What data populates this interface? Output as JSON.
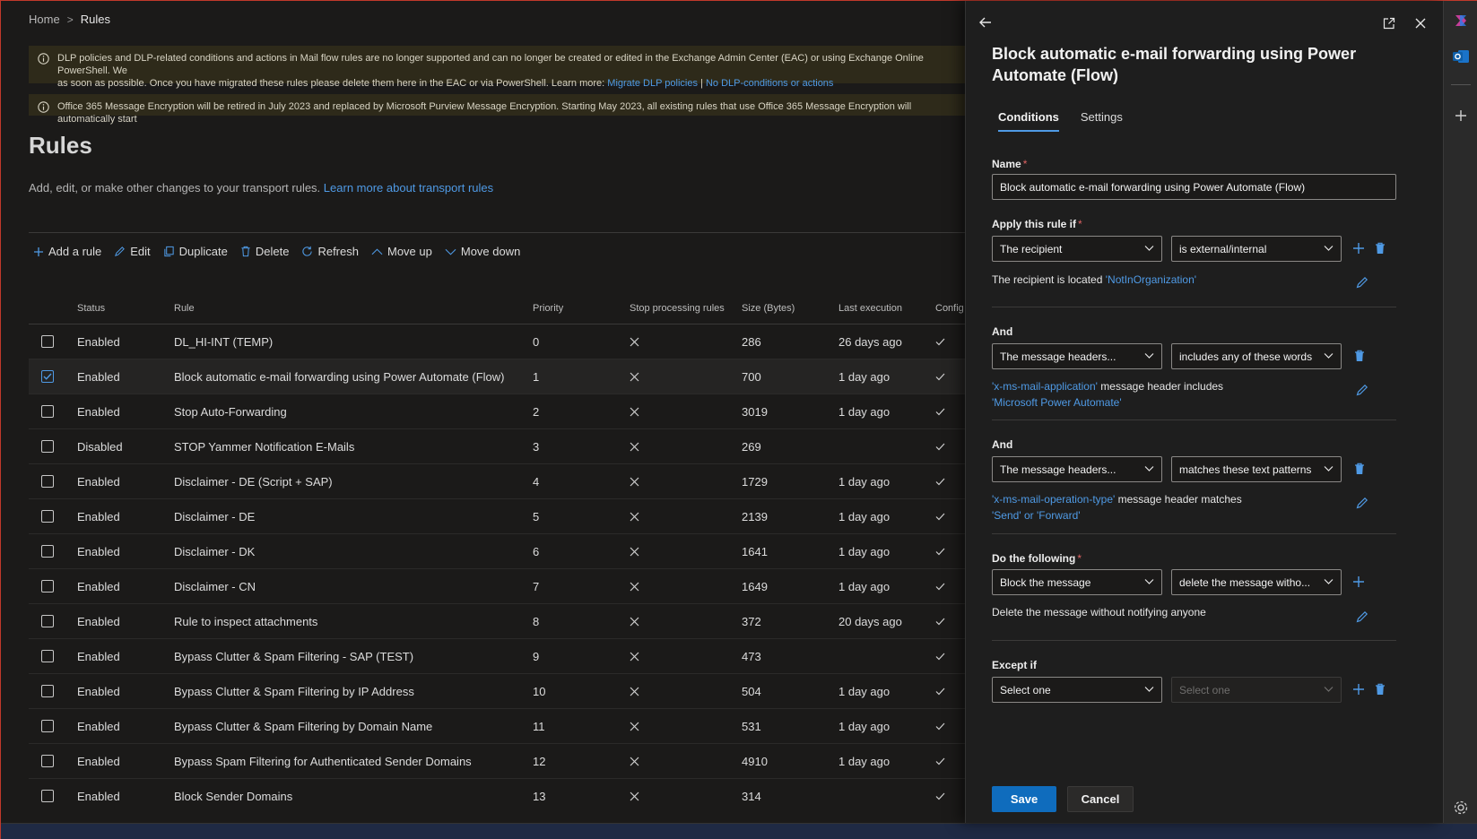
{
  "breadcrumb": {
    "home": "Home",
    "separator": ">",
    "current": "Rules"
  },
  "banners": [
    {
      "text": "DLP policies and DLP-related conditions and actions in Mail flow rules are no longer supported and can no longer be created or edited in the Exchange Admin Center (EAC) or using Exchange Online PowerShell. We",
      "text2": "as soon as possible. Once you have migrated these rules please delete them here in the EAC or via PowerShell. Learn more:",
      "link1": "Migrate DLP policies",
      "divider": "|",
      "link2": "No DLP-conditions or actions"
    },
    {
      "text": "Office 365 Message Encryption will be retired in July 2023 and replaced by Microsoft Purview Message Encryption. Starting May 2023, all existing rules that use Office 365 Message Encryption will automatically start"
    }
  ],
  "page": {
    "title": "Rules",
    "subtitle": "Add, edit, or make other changes to your transport rules.",
    "subtitle_link": "Learn more about transport rules"
  },
  "toolbar": {
    "add": "Add a rule",
    "edit": "Edit",
    "duplicate": "Duplicate",
    "delete": "Delete",
    "refresh": "Refresh",
    "move_up": "Move up",
    "move_down": "Move down"
  },
  "table": {
    "headers": {
      "status": "Status",
      "rule": "Rule",
      "priority": "Priority",
      "stop": "Stop processing rules",
      "size": "Size (Bytes)",
      "last": "Last execution",
      "config": "Config"
    },
    "rows": [
      {
        "status": "Enabled",
        "rule": "DL_HI-INT (TEMP)",
        "priority": "0",
        "size": "286",
        "last": "26 days ago",
        "selected": false
      },
      {
        "status": "Enabled",
        "rule": "Block automatic e-mail forwarding using Power Automate (Flow)",
        "priority": "1",
        "size": "700",
        "last": "1 day ago",
        "selected": true
      },
      {
        "status": "Enabled",
        "rule": "Stop Auto-Forwarding",
        "priority": "2",
        "size": "3019",
        "last": "1 day ago",
        "selected": false
      },
      {
        "status": "Disabled",
        "rule": "STOP Yammer Notification E-Mails",
        "priority": "3",
        "size": "269",
        "last": "",
        "selected": false
      },
      {
        "status": "Enabled",
        "rule": "Disclaimer - DE (Script + SAP)",
        "priority": "4",
        "size": "1729",
        "last": "1 day ago",
        "selected": false
      },
      {
        "status": "Enabled",
        "rule": "Disclaimer - DE",
        "priority": "5",
        "size": "2139",
        "last": "1 day ago",
        "selected": false
      },
      {
        "status": "Enabled",
        "rule": "Disclaimer - DK",
        "priority": "6",
        "size": "1641",
        "last": "1 day ago",
        "selected": false
      },
      {
        "status": "Enabled",
        "rule": "Disclaimer - CN",
        "priority": "7",
        "size": "1649",
        "last": "1 day ago",
        "selected": false
      },
      {
        "status": "Enabled",
        "rule": "Rule to inspect attachments",
        "priority": "8",
        "size": "372",
        "last": "20 days ago",
        "selected": false
      },
      {
        "status": "Enabled",
        "rule": "Bypass Clutter & Spam Filtering - SAP (TEST)",
        "priority": "9",
        "size": "473",
        "last": "",
        "selected": false
      },
      {
        "status": "Enabled",
        "rule": "Bypass Clutter & Spam Filtering by IP Address",
        "priority": "10",
        "size": "504",
        "last": "1 day ago",
        "selected": false
      },
      {
        "status": "Enabled",
        "rule": "Bypass Clutter & Spam Filtering by Domain Name",
        "priority": "11",
        "size": "531",
        "last": "1 day ago",
        "selected": false
      },
      {
        "status": "Enabled",
        "rule": "Bypass Spam Filtering for Authenticated Sender Domains",
        "priority": "12",
        "size": "4910",
        "last": "1 day ago",
        "selected": false
      },
      {
        "status": "Enabled",
        "rule": "Block Sender Domains",
        "priority": "13",
        "size": "314",
        "last": "",
        "selected": false
      }
    ]
  },
  "panel": {
    "title": "Block automatic e-mail forwarding using Power Automate (Flow)",
    "tabs": [
      "Conditions",
      "Settings"
    ],
    "name_label": "Name",
    "name_value": "Block automatic e-mail forwarding using Power Automate (Flow)",
    "apply_label": "Apply this rule if",
    "apply_dd1": "The recipient",
    "apply_dd2": "is external/internal",
    "apply_desc_text": "The recipient is located",
    "apply_desc_value": "'NotInOrganization'",
    "and1_label": "And",
    "and1_dd1": "The message headers...",
    "and1_dd2": "includes any of these words",
    "and1_desc_value1": "'x-ms-mail-application'",
    "and1_desc_text": "message header includes",
    "and1_desc_value2": "'Microsoft Power Automate'",
    "and2_label": "And",
    "and2_dd1": "The message headers...",
    "and2_dd2": "matches these text patterns",
    "and2_desc_value1": "'x-ms-mail-operation-type'",
    "and2_desc_text": "message header matches",
    "and2_desc_value2": "'Send' or 'Forward'",
    "do_label": "Do the following",
    "do_dd1": "Block the message",
    "do_dd2": "delete the message witho...",
    "do_desc": "Delete the message without notifying anyone",
    "except_label": "Except if",
    "except_dd1": "Select one",
    "except_dd2": "Select one",
    "required_mark": "*",
    "save": "Save",
    "cancel": "Cancel"
  },
  "colors": {
    "accent": "#4f9ae5",
    "primary_button": "#0f6cbd",
    "danger": "#e06363"
  }
}
